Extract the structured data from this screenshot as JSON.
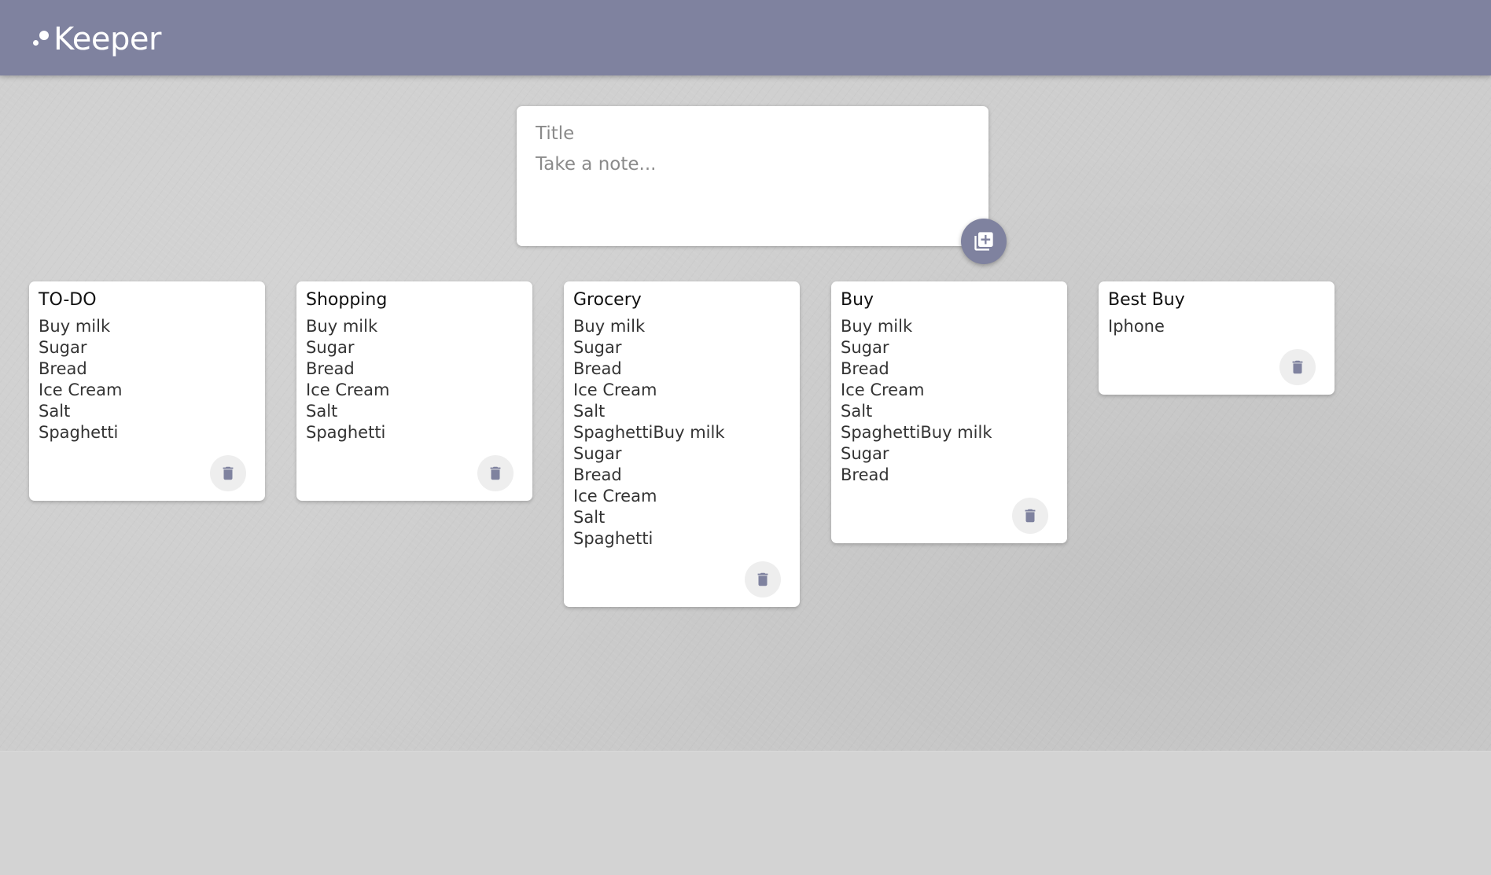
{
  "header": {
    "app_name": "Keeper",
    "logo_icon": "dots-logo-icon",
    "color": "#7f829f"
  },
  "composer": {
    "title_placeholder": "Title",
    "content_placeholder": "Take a note...",
    "add_icon": "add-note-icon"
  },
  "notes": [
    {
      "title": "TO-DO",
      "content": "Buy milk\nSugar\nBread\nIce Cream\nSalt\nSpaghetti"
    },
    {
      "title": "Shopping",
      "content": "Buy milk\nSugar\nBread\nIce Cream\nSalt\nSpaghetti"
    },
    {
      "title": "Grocery",
      "content": "Buy milk\nSugar\nBread\nIce Cream\nSalt\nSpaghettiBuy milk\nSugar\nBread\nIce Cream\nSalt\nSpaghetti"
    },
    {
      "title": "Buy",
      "content": "Buy milk\nSugar\nBread\nIce Cream\nSalt\nSpaghettiBuy milk\nSugar\nBread"
    },
    {
      "title": "Best Buy",
      "content": "Iphone"
    }
  ],
  "delete_icon": "trash-icon",
  "colors": {
    "accent": "#7f829f",
    "background": "#cdcdcd",
    "card": "#ffffff"
  }
}
